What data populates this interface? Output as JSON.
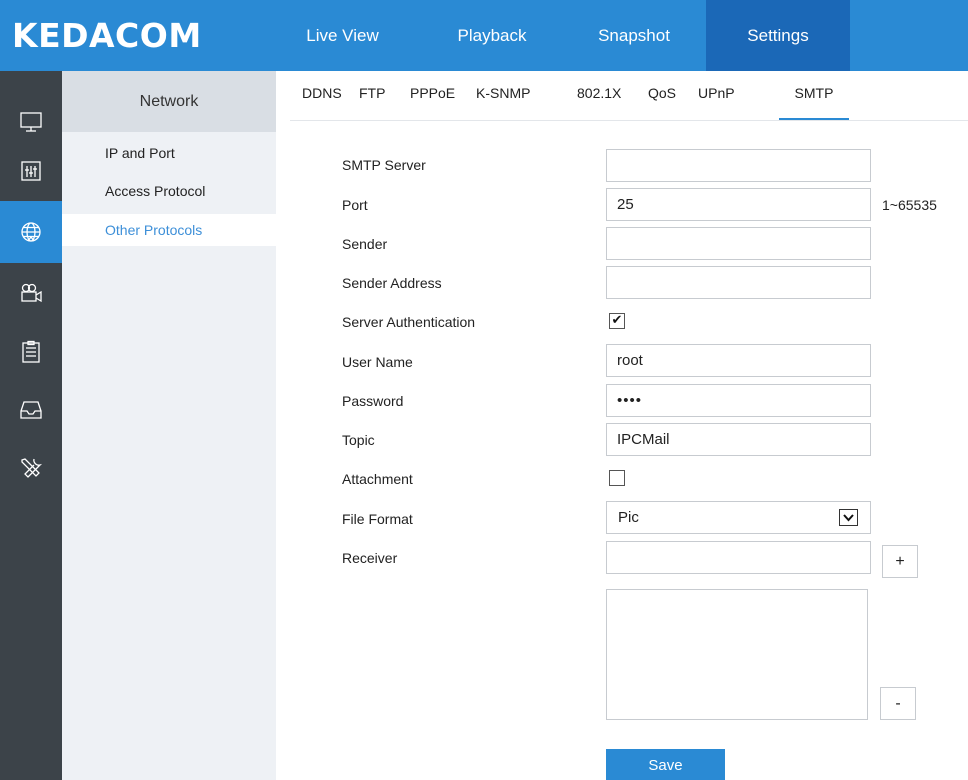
{
  "brand": {
    "logo": "KEDACOM"
  },
  "topnav": [
    "Live View",
    "Playback",
    "Snapshot",
    "Settings"
  ],
  "rail_icons": [
    "monitor-icon",
    "sliders-icon",
    "globe-icon",
    "camera-icon",
    "clipboard-icon",
    "tray-icon",
    "tools-icon"
  ],
  "submenu": {
    "title": "Network",
    "items": [
      "IP and Port",
      "Access Protocol",
      "Other Protocols"
    ]
  },
  "tabs": [
    "DDNS",
    "FTP",
    "PPPoE",
    "K-SNMP",
    "802.1X",
    "QoS",
    "UPnP",
    "SMTP"
  ],
  "form": {
    "smtp_server": {
      "label": "SMTP Server",
      "value": ""
    },
    "port": {
      "label": "Port",
      "value": "25",
      "range": "1~65535"
    },
    "sender": {
      "label": "Sender",
      "value": ""
    },
    "sender_address": {
      "label": "Sender Address",
      "value": ""
    },
    "server_auth": {
      "label": "Server Authentication",
      "checked": true,
      "mark": "✔"
    },
    "user_name": {
      "label": "User Name",
      "value": "root"
    },
    "password": {
      "label": "Password",
      "value": "••••"
    },
    "topic": {
      "label": "Topic",
      "value": "IPCMail"
    },
    "attachment": {
      "label": "Attachment",
      "checked": false
    },
    "file_format": {
      "label": "File Format",
      "value": "Pic"
    },
    "receiver": {
      "label": "Receiver",
      "value": "",
      "add": "+",
      "remove": "-"
    }
  },
  "save_label": "Save",
  "colors": {
    "accent": "#2a8ad4",
    "accent_dark": "#1b68b7",
    "rail": "#3c4349",
    "active_link": "#3d8fd8"
  }
}
